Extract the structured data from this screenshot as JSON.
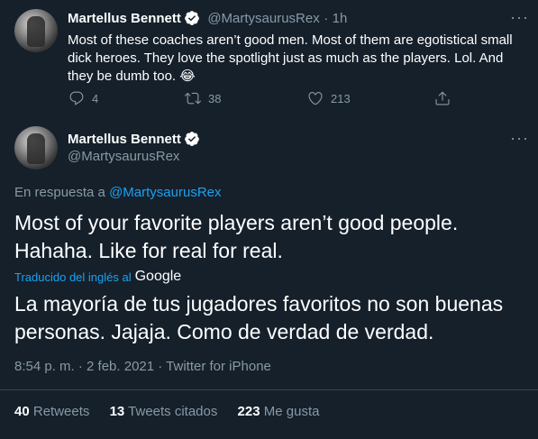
{
  "tweet1": {
    "name": "Martellus Bennett",
    "handle": "@MartysaurusRex",
    "separator": "·",
    "time": "1h",
    "text": "Most of these coaches aren’t good men. Most of them are egotistical small dick heroes. They love the spotlight just as much as the players. Lol. And they be dumb too. 😂",
    "replies": "4",
    "retweets": "38",
    "likes": "213"
  },
  "tweet2": {
    "name": "Martellus Bennett",
    "handle": "@MartysaurusRex",
    "reply_prefix": "En respuesta a",
    "reply_handle": "@MartysaurusRex",
    "text": "Most of your favorite players aren’t good people. Hahaha. Like for real for real.",
    "translated_label": "Traducido del inglés al",
    "translator": "Google",
    "translation": "La mayoría de tus jugadores favoritos no son buenas personas. Jajaja. Como de verdad de verdad.",
    "timestamp": "8:54 p. m. · 2 feb. 2021 · Twitter for iPhone",
    "stats": {
      "retweets_count": "40",
      "retweets_label": "Retweets",
      "quotes_count": "13",
      "quotes_label": "Tweets citados",
      "likes_count": "223",
      "likes_label": "Me gusta"
    }
  },
  "colors": {
    "background": "#15202b",
    "text": "#ffffff",
    "secondary": "#8899a6",
    "accent": "#1da1f2",
    "divider": "#38444d"
  },
  "icons": [
    "verified-badge-icon",
    "more-icon",
    "reply-icon",
    "retweet-icon",
    "like-icon",
    "share-icon"
  ]
}
